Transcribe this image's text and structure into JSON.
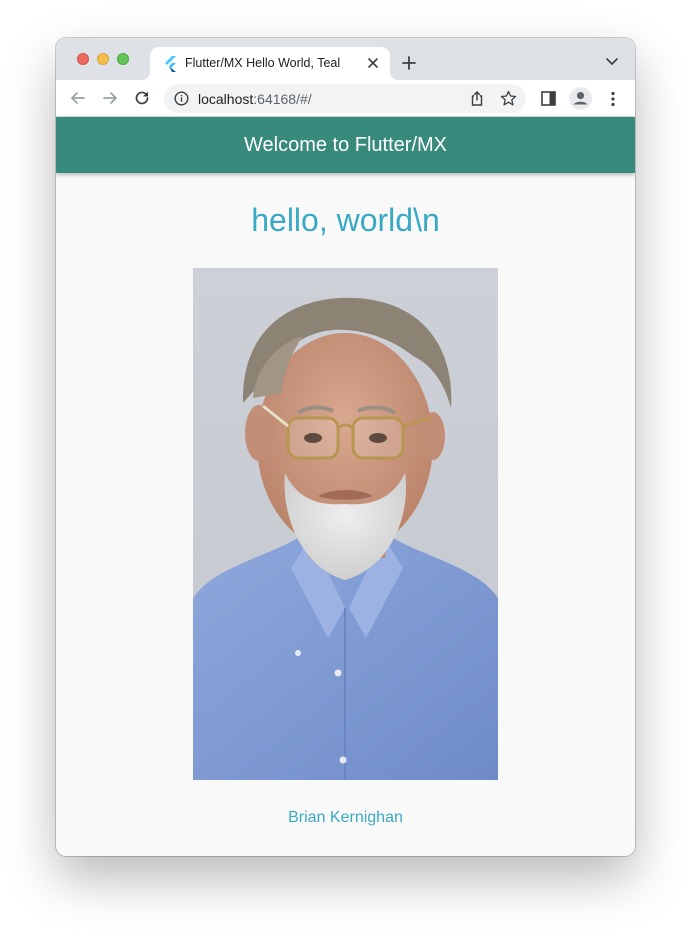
{
  "browser": {
    "tab_title": "Flutter/MX Hello World, Teal",
    "url_host": "localhost",
    "url_rest": ":64168/#/"
  },
  "icons": {
    "favicon": "flutter-logo-icon",
    "tab_close": "close-icon",
    "new_tab": "plus-icon",
    "tab_search": "chevron-down-icon",
    "back": "arrow-left-icon",
    "forward": "arrow-right-icon",
    "reload": "reload-icon",
    "site_info": "info-icon",
    "share": "share-icon",
    "bookmark": "star-icon",
    "side_panel": "side-panel-icon",
    "profile": "profile-icon",
    "menu": "kebab-menu-icon"
  },
  "app": {
    "appbar_title": "Welcome to Flutter/MX",
    "headline": "hello, world\\n",
    "caption": "Brian Kernighan"
  },
  "colors": {
    "appbar": "#378a7c",
    "accent_text": "#3aa9c4",
    "page_bg": "#f9f9fa"
  }
}
